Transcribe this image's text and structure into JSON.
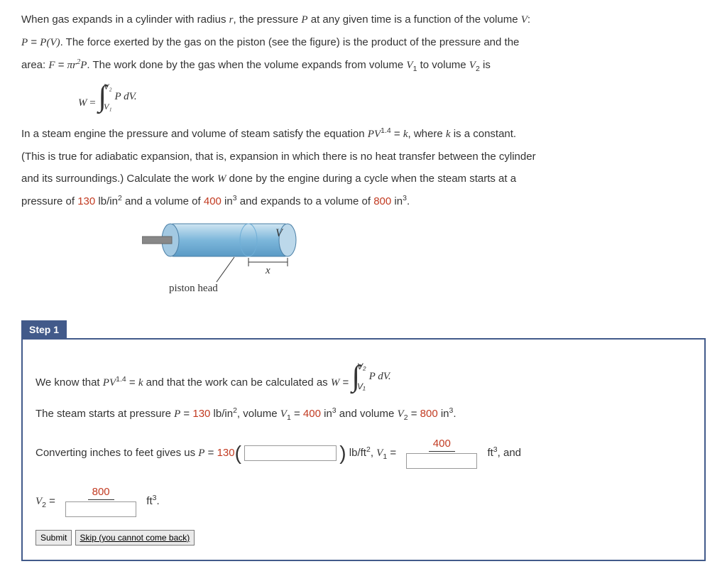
{
  "problem": {
    "intro_line1": "When gas expands in a cylinder with radius ",
    "r": "r",
    "intro_line1b": ", the pressure ",
    "P": "P",
    "intro_line1c": " at any given time is a function of the volume ",
    "V": "V",
    "intro_line1d": ":",
    "intro_line2a": " = ",
    "PV": "P(V)",
    "intro_line2b": ". The force exerted by the gas on the piston (see the figure) is the product of the pressure and the",
    "intro_line3a": "area: ",
    "F": "F",
    "eq": " = ",
    "pi_r2_p": "πr",
    "pi_r2_p_exp": "2",
    "pi_r2_p_suffix": "P",
    "intro_line3c": ". The work done by the gas when the volume expands from volume ",
    "V1": "V",
    "one": "1",
    "to_text": " to volume ",
    "V2": "V",
    "two": "2",
    "is_text": " is",
    "W": "W",
    "int_upper": "V₂",
    "int_lower": "V₁",
    "P_dV": "P dV.",
    "steam_line1a": "In a steam engine the pressure and volume of steam satisfy the equation ",
    "PV14": "PV",
    "exp14": "1.4",
    "eq_k": " = ",
    "k": "k",
    "where_const": ", where ",
    "is_const": " is a constant.",
    "adiabatic": "(This is true for adiabatic expansion, that is, expansion in which there is no heat transfer between the cylinder",
    "surroundings": "and its surroundings.) Calculate the work ",
    "W_sym": "W",
    "done_by": " done by the engine during a cycle when the steam starts at a",
    "pressure_of": "pressure of ",
    "p_val": "130",
    "lb_in2": " lb/in",
    "and_vol": " and a volume of ",
    "v1_val": "400",
    "in3": " in",
    "expands_to": " and expands to a volume of ",
    "v2_val": "800",
    "period": "."
  },
  "diagram": {
    "v_label": "V",
    "x_label": "x",
    "caption": "piston head"
  },
  "step1": {
    "title": "Step 1",
    "know": "We know that ",
    "PV14": "PV",
    "exp14": "1.4",
    "eq_k": " = ",
    "k": "k",
    "and_work": " and that the work can be calculated as  ",
    "W": "W",
    "eq": " = ",
    "int_upper": "V₂",
    "int_lower": "V₁",
    "P_dV": "P dV.",
    "steam_starts": "The steam starts at pressure ",
    "P": "P",
    "p_val": "130",
    "lb_in2": " lb/in",
    "comma_vol": ", volume ",
    "V1": "V",
    "one": "1",
    "v1_val": "400",
    "in3": " in",
    "and_vol": " and volume ",
    "V2": "V",
    "two": "2",
    "v2_val": "800",
    "period": ".",
    "converting": "Converting inches to feet gives us  ",
    "p_130": "130",
    "lb_ft2": " lb/ft",
    "comma": ",  ",
    "v1_num": "400",
    "ft3": " ft",
    "and": ", and",
    "v2_num": "800",
    "v2_eq": " = "
  },
  "buttons": {
    "submit": "Submit",
    "skip": "Skip (you cannot come back)"
  }
}
